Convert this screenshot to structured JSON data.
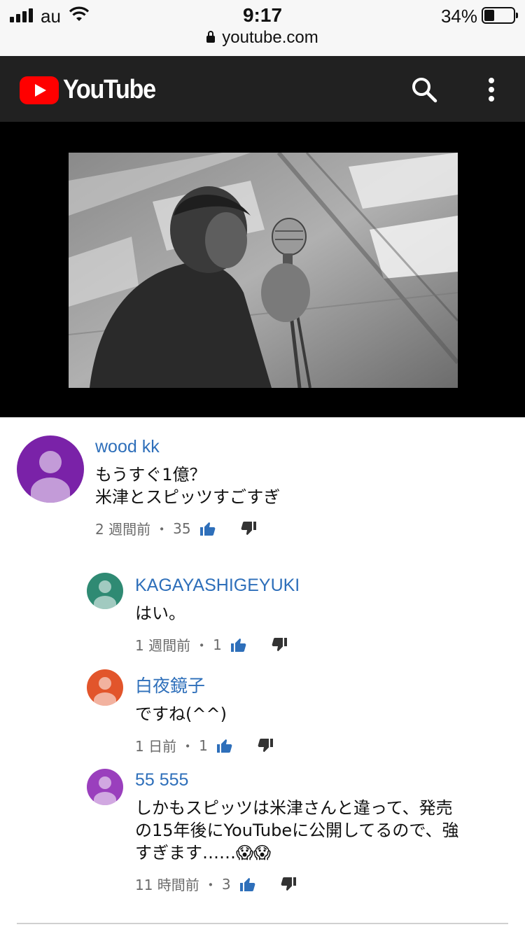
{
  "status_bar": {
    "carrier": "au",
    "time": "9:17",
    "battery_percent": "34%",
    "battery_level": 0.34,
    "url": "youtube.com"
  },
  "header": {
    "logo_text": "YouTube",
    "icons": [
      "youtube-logo-icon",
      "search-icon",
      "more-vert-icon"
    ],
    "brand_color": "#ff0000",
    "bg_color": "#212121"
  },
  "video": {
    "thumbnail": "black-and-white frame of a singer at a vintage microphone"
  },
  "comments": [
    {
      "author": "wood kk",
      "text": "もうすぐ1億？\n米津とスピッツすごすぎ",
      "time": "2 週間前",
      "likes": "35",
      "avatar_color": "#7a22a8"
    },
    {
      "author": "KAGAYASHIGEYUKI",
      "text": "はい。",
      "time": "1 週間前",
      "likes": "1",
      "avatar_color": "#2f8a73"
    },
    {
      "author": "白夜鏡子",
      "text": "ですね(^^)",
      "time": "1 日前",
      "likes": "1",
      "avatar_color": "#e2552b"
    },
    {
      "author": "55 555",
      "text": "しかもスピッツは米津さんと違って、発売\nの15年後にYouTubeに公開してるので、強\nすぎます……😱😱",
      "time": "11 時間前",
      "likes": "3",
      "avatar_color": "#9a3fbd"
    }
  ],
  "separator": "・",
  "colors": {
    "author_link": "#2e6fba",
    "thumb_up": "#2e6fba",
    "thumb_down": "#333333"
  }
}
